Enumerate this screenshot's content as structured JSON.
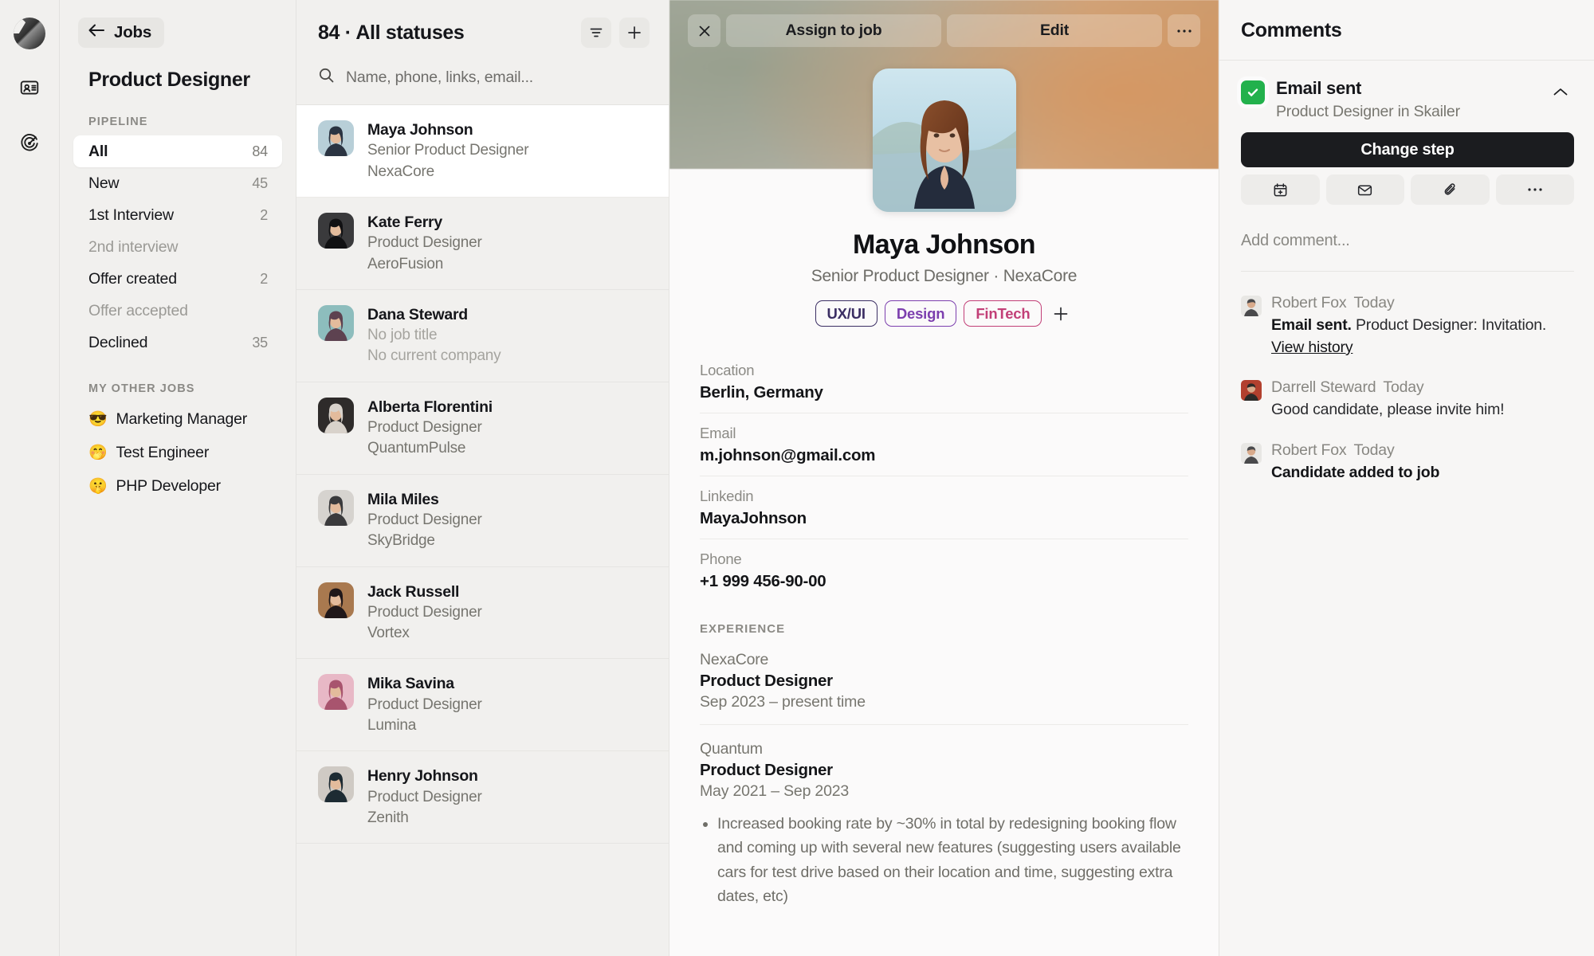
{
  "rail": {
    "logo": "skailer-logo",
    "items": [
      {
        "icon": "contact-card-icon",
        "name": "candidates"
      },
      {
        "icon": "target-icon",
        "name": "goals"
      }
    ]
  },
  "sidebar": {
    "back_label": "Jobs",
    "job_title": "Product Designer",
    "pipeline_caption": "PIPELINE",
    "pipeline": [
      {
        "label": "All",
        "count": "84",
        "active": true,
        "muted": false
      },
      {
        "label": "New",
        "count": "45",
        "active": false,
        "muted": false
      },
      {
        "label": "1st Interview",
        "count": "2",
        "active": false,
        "muted": false
      },
      {
        "label": "2nd interview",
        "count": "",
        "active": false,
        "muted": true
      },
      {
        "label": "Offer created",
        "count": "2",
        "active": false,
        "muted": false
      },
      {
        "label": "Offer accepted",
        "count": "",
        "active": false,
        "muted": true
      },
      {
        "label": "Declined",
        "count": "35",
        "active": false,
        "muted": false
      }
    ],
    "other_jobs_caption": "MY OTHER JOBS",
    "other_jobs": [
      {
        "emoji": "😎",
        "label": "Marketing Manager"
      },
      {
        "emoji": "🤭",
        "label": "Test Engineer"
      },
      {
        "emoji": "🤫",
        "label": "PHP Developer"
      }
    ]
  },
  "list": {
    "title": "84 · All statuses",
    "filter_icon": "filter-icon",
    "add_icon": "plus-icon",
    "search_placeholder": "Name, phone, links, email...",
    "candidates": [
      {
        "name": "Maya Johnson",
        "role": "Senior Product Designer",
        "company": "NexaCore",
        "selected": true,
        "faint": false,
        "av1": "#b8cfd8",
        "av2": "#2b3442"
      },
      {
        "name": "Kate Ferry",
        "role": "Product Designer",
        "company": "AeroFusion",
        "selected": false,
        "faint": false,
        "av1": "#3a3a3c",
        "av2": "#111113"
      },
      {
        "name": "Dana Steward",
        "role": "No job title",
        "company": "No current company",
        "selected": false,
        "faint": true,
        "av1": "#8dbdbd",
        "av2": "#5d4250"
      },
      {
        "name": "Alberta Florentini",
        "role": "Product Designer",
        "company": "QuantumPulse",
        "selected": false,
        "faint": false,
        "av1": "#2e2b2a",
        "av2": "#d8d2cb"
      },
      {
        "name": "Mila Miles",
        "role": "Product Designer",
        "company": "SkyBridge",
        "selected": false,
        "faint": false,
        "av1": "#d6d3cf",
        "av2": "#3a3a3c"
      },
      {
        "name": "Jack Russell",
        "role": "Product Designer",
        "company": "Vortex",
        "selected": false,
        "faint": false,
        "av1": "#a9794f",
        "av2": "#20181a"
      },
      {
        "name": "Mika Savina",
        "role": "Product Designer",
        "company": "Lumina",
        "selected": false,
        "faint": false,
        "av1": "#e8b8c6",
        "av2": "#a8546e"
      },
      {
        "name": "Henry Johnson",
        "role": "Product Designer",
        "company": "Zenith",
        "selected": false,
        "faint": false,
        "av1": "#cfcac4",
        "av2": "#1d2b33"
      }
    ]
  },
  "detail": {
    "toolbar": {
      "close_icon": "close-icon",
      "assign_label": "Assign to job",
      "edit_label": "Edit",
      "more_icon": "ellipsis-icon"
    },
    "name": "Maya Johnson",
    "subtitle": "Senior Product Designer · NexaCore",
    "tags": [
      {
        "label": "UX/UI",
        "color": "#3b2e63"
      },
      {
        "label": "Design",
        "color": "#7c3fae"
      },
      {
        "label": "FinTech",
        "color": "#c23f77"
      }
    ],
    "add_tag_icon": "plus-icon",
    "fields": [
      {
        "label": "Location",
        "value": "Berlin, Germany"
      },
      {
        "label": "Email",
        "value": "m.johnson@gmail.com"
      },
      {
        "label": "Linkedin",
        "value": "MayaJohnson"
      },
      {
        "label": "Phone",
        "value": "+1 999 456-90-00"
      }
    ],
    "experience_caption": "EXPERIENCE",
    "experience": [
      {
        "company": "NexaCore",
        "role": "Product Designer",
        "dates": "Sep 2023 – present time",
        "bullets": []
      },
      {
        "company": "Quantum",
        "role": "Product Designer",
        "dates": "May 2021 – Sep 2023",
        "bullets": [
          "Increased booking rate by ~30% in total by redesigning booking flow and coming up with several new features (suggesting users available cars for test drive based on their location and time, suggesting extra dates, etc)"
        ]
      }
    ]
  },
  "comments": {
    "title": "Comments",
    "step": {
      "status_icon": "check-icon",
      "status_title": "Email sent",
      "status_sub": "Product Designer in Skailer",
      "collapse_icon": "chevron-up-icon",
      "change_step_label": "Change step",
      "actions": [
        {
          "icon": "calendar-plus-icon",
          "name": "schedule"
        },
        {
          "icon": "envelope-icon",
          "name": "email"
        },
        {
          "icon": "paperclip-icon",
          "name": "attach"
        },
        {
          "icon": "ellipsis-icon",
          "name": "more"
        }
      ]
    },
    "add_comment_placeholder": "Add comment...",
    "items": [
      {
        "author": "Robert Fox",
        "time": "Today",
        "bold_prefix": "Email sent.",
        "text": " Product Designer: Invitation. ",
        "link": "View history",
        "all_bold": false,
        "av1": "#e8e7e4",
        "av2": "#4a4a4c"
      },
      {
        "author": "Darrell Steward",
        "time": "Today",
        "bold_prefix": "",
        "text": "Good candidate, please invite him!",
        "link": "",
        "all_bold": false,
        "av1": "#b2402e",
        "av2": "#2c2a28"
      },
      {
        "author": "Robert Fox",
        "time": "Today",
        "bold_prefix": "",
        "text": "Candidate added to job",
        "link": "",
        "all_bold": true,
        "av1": "#e8e7e4",
        "av2": "#4a4a4c"
      }
    ]
  }
}
